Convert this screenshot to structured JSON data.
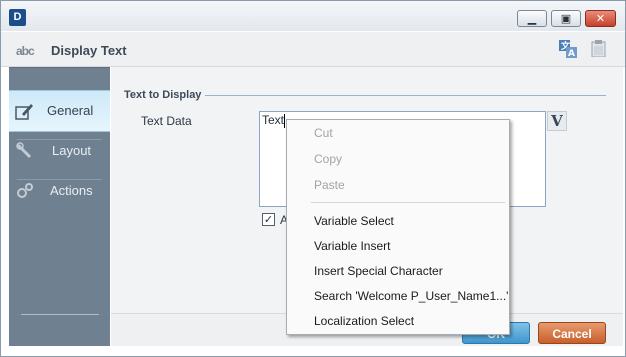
{
  "window": {
    "logo_text": "D",
    "controls": {
      "minimize_icon": "minimize-icon",
      "maximize_icon": "maximize-icon",
      "close_icon": "close-icon"
    }
  },
  "header": {
    "title": "Display Text",
    "title_icon_text": "abc",
    "actions": [
      "translate-icon",
      "clipboard-icon"
    ]
  },
  "sidebar": {
    "items": [
      {
        "label": "General",
        "icon": "pencil-icon",
        "active": true
      },
      {
        "label": "Layout",
        "icon": "wrench-icon",
        "active": false
      },
      {
        "label": "Actions",
        "icon": "gears-icon",
        "active": false
      }
    ]
  },
  "section": {
    "title": "Text to Display"
  },
  "field": {
    "label": "Text Data",
    "value": "Text",
    "variable_button": "V"
  },
  "checkbox": {
    "label_visible": "A",
    "checked": true
  },
  "footer": {
    "ok_label": "OK",
    "cancel_label": "Cancel"
  },
  "context_menu": {
    "items": [
      {
        "label": "Cut",
        "enabled": false
      },
      {
        "label": "Copy",
        "enabled": false
      },
      {
        "label": "Paste",
        "enabled": false
      },
      {
        "label": "Variable Select",
        "enabled": true
      },
      {
        "label": "Variable Insert",
        "enabled": true
      },
      {
        "label": "Insert Special Character",
        "enabled": true
      },
      {
        "label": "Search 'Welcome P_User_Name1...'",
        "enabled": true
      },
      {
        "label": "Localization Select",
        "enabled": true
      }
    ]
  },
  "colors": {
    "sidebar": "#6f8090",
    "active_nav": "#cde9f8",
    "ok_button": "#3f96cc",
    "cancel_button": "#c85f2c",
    "close_button": "#c6402b"
  }
}
